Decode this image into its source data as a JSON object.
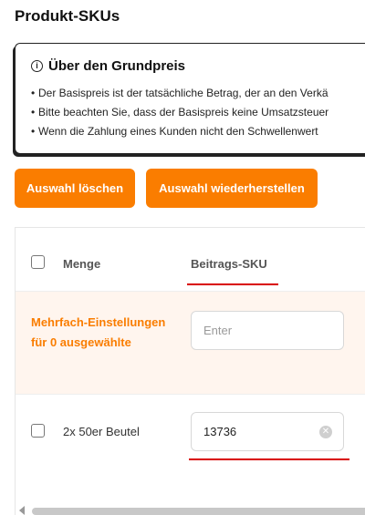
{
  "page": {
    "title": "Produkt-SKUs"
  },
  "info": {
    "icon": "info-icon",
    "title": "Über den Grundpreis",
    "lines": [
      "Der Basispreis ist der tatsächliche Betrag, der an den Verkä",
      "Bitte beachten Sie, dass der Basispreis keine Umsatzsteuer",
      "Wenn die Zahlung eines Kunden nicht den Schwellenwert"
    ]
  },
  "toolbar": {
    "clear_label": "Auswahl löschen",
    "restore_label": "Auswahl wiederherstellen",
    "accent_color": "#fa7d00"
  },
  "table": {
    "headers": {
      "quantity": "Menge",
      "sku": "Beitrags-SKU"
    },
    "bulk": {
      "label": "Mehrfach-Einstellungen für 0 ausgewählte",
      "placeholder": "Enter"
    },
    "rows": [
      {
        "quantity": "2x 50er Beutel",
        "sku": "13736"
      }
    ]
  }
}
